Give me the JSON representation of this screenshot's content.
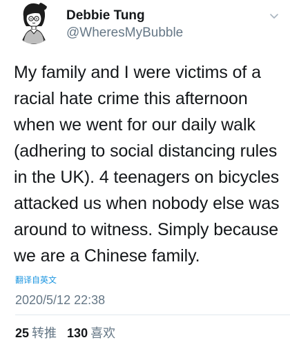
{
  "author": {
    "display_name": "Debbie Tung",
    "handle": "@WheresMyBubble",
    "avatar_icon": "cartoon-avatar-icon"
  },
  "tweet": {
    "lines": [
      "My family and I were victims of a",
      "racial hate crime this afternoon",
      "when we went for our daily walk",
      "(adhering to social distancing rules",
      "in the UK). 4 teenagers on bicycles",
      "attacked us when nobody else was",
      "around to witness. Simply because",
      "we are a Chinese family."
    ],
    "translate_label": "翻译自英文",
    "timestamp": "2020/5/12 22:38"
  },
  "stats": {
    "retweets_count": "25",
    "retweets_label": "转推",
    "likes_count": "130",
    "likes_label": "喜欢"
  },
  "colors": {
    "text": "#14171a",
    "secondary": "#657786",
    "link": "#1b95e0",
    "divider": "#e1e8ed"
  },
  "menu_icon": "chevron-down-icon"
}
